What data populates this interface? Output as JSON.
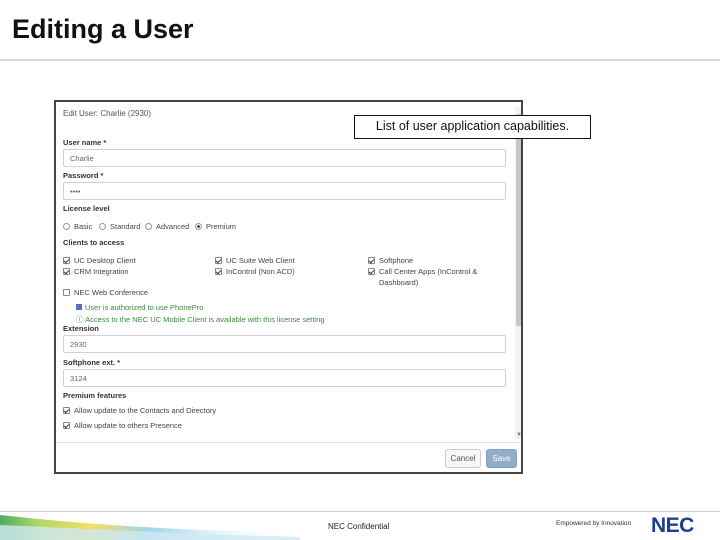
{
  "slide": {
    "title": "Editing a User",
    "callout": "List of user application capabilities.",
    "footer_confidential": "NEC Confidential",
    "tagline": "Empowered by Innovation",
    "logo": "NEC"
  },
  "dialog": {
    "title": "Edit User: Charlie (2930)",
    "user_name": {
      "label": "User name *",
      "value": "Charlie"
    },
    "password": {
      "label": "Password *",
      "value": "••••"
    },
    "license": {
      "label": "License level",
      "options": [
        "Basic",
        "Standard",
        "Advanced",
        "Premium"
      ],
      "selected": "Premium"
    },
    "clients": {
      "label": "Clients to access",
      "items": [
        {
          "label": "UC Desktop Client",
          "checked": true
        },
        {
          "label": "UC Suite Web Client",
          "checked": true
        },
        {
          "label": "Softphone",
          "checked": true
        },
        {
          "label": "CRM Integration",
          "checked": true
        },
        {
          "label": "InControl (Non ACD)",
          "checked": true
        },
        {
          "label": "Call Center Apps (InControl &",
          "label2": "Dashboard)",
          "checked": true
        },
        {
          "label": "NEC Web Conference",
          "checked": false
        }
      ],
      "phonepro_note": "User is authorized to use PhonePro",
      "mobile_note": "Access to the NEC UC Mobile Client is available with this license setting"
    },
    "extension": {
      "label": "Extension",
      "value": "2930"
    },
    "softphone_ext": {
      "label": "Softphone ext. *",
      "value": "3124"
    },
    "premium": {
      "label": "Premium features",
      "items": [
        {
          "label": "Allow update to the Contacts and Directory",
          "checked": true
        },
        {
          "label": "Allow update to others Presence",
          "checked": true
        }
      ]
    },
    "buttons": {
      "cancel": "Cancel",
      "save": "Save"
    }
  },
  "colors": {
    "save_button": "#92acc8",
    "green_note": "#3c8a3c",
    "logo_blue": "#1c3f94"
  }
}
